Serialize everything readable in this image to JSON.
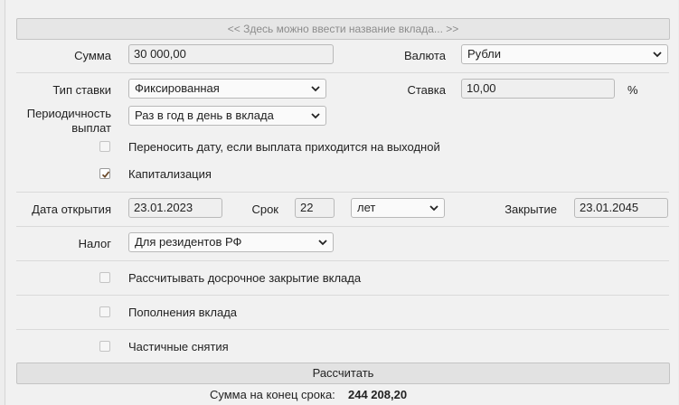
{
  "deposit_name": {
    "placeholder": "<< Здесь можно ввести название вклада... >>"
  },
  "amount": {
    "label": "Сумма",
    "value": "30 000,00"
  },
  "currency": {
    "label": "Валюта",
    "value": "Рубли"
  },
  "rate_type": {
    "label": "Тип ставки",
    "value": "Фиксированная"
  },
  "rate": {
    "label": "Ставка",
    "value": "10,00",
    "unit": "%"
  },
  "periodicity": {
    "label_line1": "Периодичность",
    "label_line2": "выплат",
    "value": "Раз в год в день в вклада"
  },
  "move_date": {
    "label": "Переносить дату, если выплата приходится на выходной",
    "checked": false
  },
  "capitalization": {
    "label": "Капитализация",
    "checked": true
  },
  "open_date": {
    "label": "Дата открытия",
    "value": "23.01.2023"
  },
  "term": {
    "label": "Срок",
    "value": "22",
    "unit_value": "лет"
  },
  "close_date": {
    "label": "Закрытие",
    "value": "23.01.2045"
  },
  "tax": {
    "label": "Налог",
    "value": "Для резидентов РФ"
  },
  "early_close": {
    "label": "Рассчитывать досрочное закрытие вклада",
    "checked": false
  },
  "replenish": {
    "label": "Пополнения вклада",
    "checked": false
  },
  "withdrawals": {
    "label": "Частичные снятия",
    "checked": false
  },
  "calculate_button": {
    "label": "Рассчитать"
  },
  "result": {
    "label": "Сумма на конец срока:",
    "value": "244 208,20"
  }
}
